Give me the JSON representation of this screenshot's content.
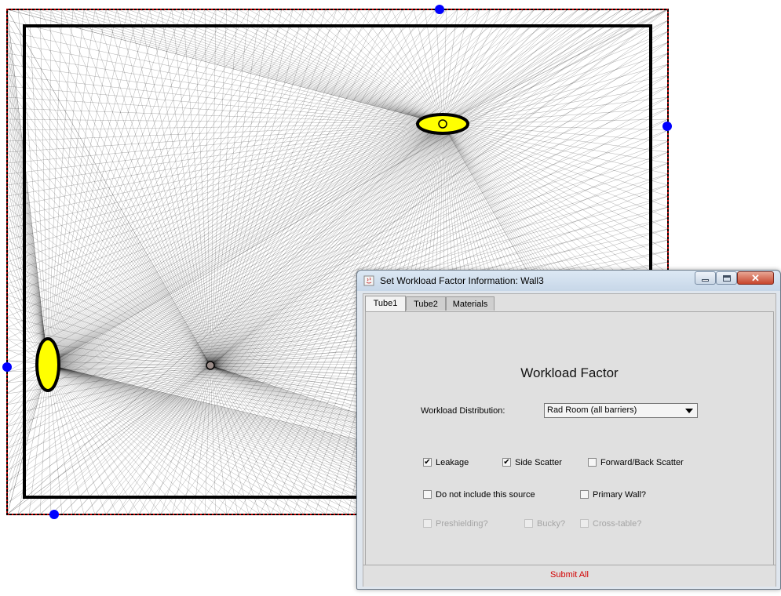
{
  "dialog": {
    "title": "Set Workload Factor Information: Wall3",
    "window_buttons": {
      "minimize": "minimize-icon",
      "maximize": "maximize-icon",
      "close": "close-icon"
    },
    "tabs": [
      {
        "label": "Tube1",
        "selected": true
      },
      {
        "label": "Tube2",
        "selected": false
      },
      {
        "label": "Materials",
        "selected": false
      }
    ],
    "heading": "Workload Factor",
    "distribution": {
      "label": "Workload Distribution:",
      "value": "Rad Room (all barriers)"
    },
    "checkboxes": {
      "leakage": {
        "label": "Leakage",
        "checked": true,
        "mark": "✔"
      },
      "side_scatter": {
        "label": "Side Scatter",
        "checked": true,
        "mark": "✔"
      },
      "forward_back_scatter": {
        "label": "Forward/Back Scatter",
        "checked": false
      },
      "do_not_include": {
        "label": "Do not include this source",
        "checked": false
      },
      "primary_wall": {
        "label": "Primary Wall?",
        "checked": false
      },
      "preshielding": {
        "label": "Preshielding?",
        "checked": false,
        "disabled": true
      },
      "bucky": {
        "label": "Bucky?",
        "checked": false,
        "disabled": true
      },
      "cross_table": {
        "label": "Cross-table?",
        "checked": false,
        "disabled": true
      }
    },
    "submit_label": "Submit All"
  },
  "colors": {
    "source_fill": "#ffff00",
    "handle": "#0000ff",
    "submit_text": "#d20000",
    "dotted_border": "#cc0000"
  }
}
